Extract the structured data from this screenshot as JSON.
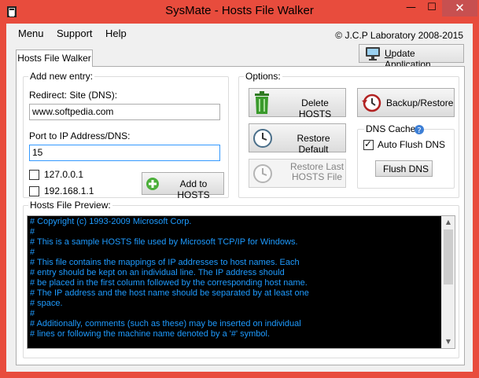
{
  "window": {
    "title": "SysMate - Hosts File Walker",
    "buttons": {
      "minimize": "—",
      "maximize": "☐",
      "close": "✕"
    }
  },
  "menu": {
    "items": [
      "Menu",
      "Support",
      "Help"
    ]
  },
  "copyright": "© J.C.P Laboratory 2008-2015",
  "update_button": {
    "label_prefix": "U",
    "label_rest": "pdate Application",
    "icon": "monitor-icon"
  },
  "tab": {
    "label": "Hosts File Walker"
  },
  "add_entry": {
    "group_title": "Add new entry:",
    "redirect_label": "Redirect: Site (DNS):",
    "redirect_value": "www.softpedia.com",
    "port_label": "Port to IP Address/DNS:",
    "port_value": "15",
    "ip_options": [
      {
        "label": "127.0.0.1",
        "checked": false
      },
      {
        "label": "192.168.1.1",
        "checked": false
      }
    ],
    "add_button": {
      "label": "Add to HOSTS",
      "icon": "plus-icon"
    }
  },
  "options": {
    "group_title": "Options:",
    "delete_button": {
      "label": "Delete HOSTS",
      "icon": "trash-icon"
    },
    "backup_button": {
      "label": "Backup/Restore",
      "icon": "restore-clock-icon"
    },
    "restore_default_button": {
      "label": "Restore Default",
      "icon": "clock-icon"
    },
    "restore_last_button": {
      "label_line1": "Restore Last",
      "label_line2": "HOSTS File",
      "icon": "clock-icon",
      "disabled": true
    },
    "dns_cache": {
      "title": "DNS Cache",
      "auto_flush_label": "Auto Flush DNS",
      "auto_flush_checked": true,
      "flush_button": "Flush DNS"
    }
  },
  "preview": {
    "group_title": "Hosts File Preview:",
    "lines": [
      "# Copyright (c) 1993-2009 Microsoft Corp.",
      "#",
      "# This is a sample HOSTS file used by Microsoft TCP/IP for Windows.",
      "#",
      "# This file contains the mappings of IP addresses to host names. Each",
      "# entry should be kept on an individual line. The IP address should",
      "# be placed in the first column followed by the corresponding host name.",
      "# The IP address and the host name should be separated by at least one",
      "# space.",
      "#",
      "# Additionally, comments (such as these) may be inserted on individual",
      "# lines or following the machine name denoted by a '#' symbol."
    ]
  },
  "colors": {
    "titlebar": "#e84c3d",
    "preview_bg": "#000000",
    "preview_text": "#1e9bff",
    "trash_green": "#3a9a2c"
  }
}
